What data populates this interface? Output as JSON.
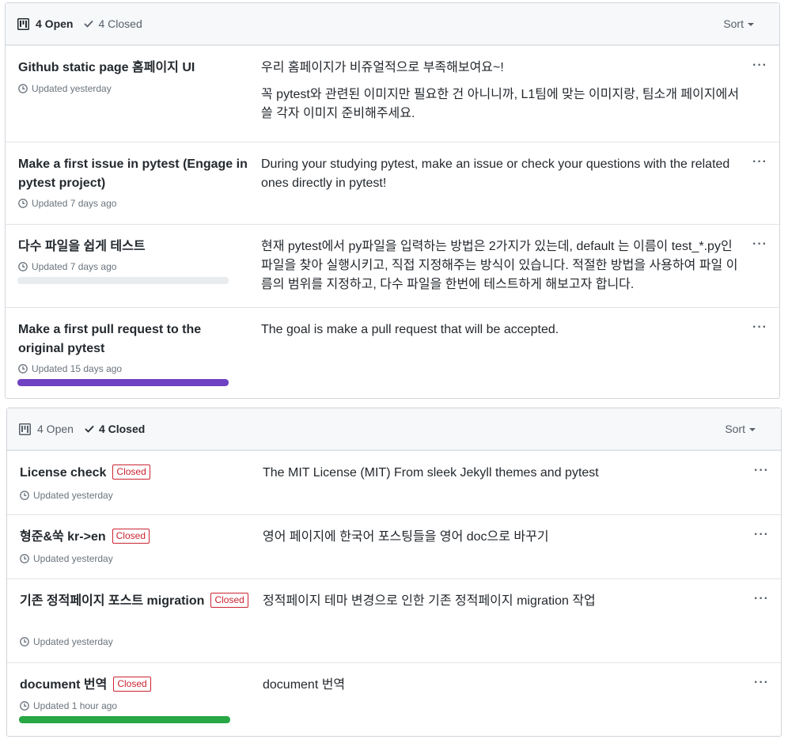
{
  "colors": {
    "purple": "#6f42c1",
    "green": "#28a745",
    "closed_red": "#cb2431",
    "track": "#e9ecef"
  },
  "panels": [
    {
      "open_label": "4 Open",
      "closed_label": "4 Closed",
      "active_state": "open",
      "sort_label": "Sort",
      "items": [
        {
          "title": "Github static page 홈페이지 UI",
          "updated": "Updated yesterday",
          "desc": [
            "우리 홈페이지가 비쥬얼적으로 부족해보여요~!",
            "꼭 pytest와 관련된 이미지만 필요한 건 아니니까, L1팀에 맞는 이미지랑, 팀소개 페이지에서 쓸 각자 이미지 준비해주세요."
          ],
          "more": "···"
        },
        {
          "title": "Make a first issue in pytest (Engage in pytest project)",
          "updated": "Updated 7 days ago",
          "desc": [
            "During your studying pytest, make an issue or check your questions with the related ones directly in pytest!"
          ],
          "more": "···"
        },
        {
          "title": "다수 파일을 쉽게 테스트",
          "updated": "Updated 7 days ago",
          "desc": [
            "현재 pytest에서 py파일을 입력하는 방법은 2가지가 있는데, default 는 이름이 test_*.py인 파일을 찾아 실행시키고, 직접 지정해주는 방식이 있습니다. 적절한 방법을 사용하여 파일 이름의 범위를 지정하고, 다수 파일을 한번에 테스트하게 해보고자 합니다."
          ],
          "more": "···",
          "progress": 0
        },
        {
          "title": "Make a first pull request to the original pytest",
          "updated": "Updated 15 days ago",
          "desc": [
            "The goal is make a pull request that will be accepted."
          ],
          "more": "···",
          "progress": 1.0
        }
      ]
    },
    {
      "open_label": "4 Open",
      "closed_label": "4 Closed",
      "active_state": "closed",
      "sort_label": "Sort",
      "items": [
        {
          "title": "License check",
          "badge": "Closed",
          "updated": "Updated yesterday",
          "desc": [
            "The MIT License (MIT) From sleek Jekyll themes and pytest"
          ],
          "more": "···"
        },
        {
          "title": "형준&쑥 kr->en",
          "badge": "Closed",
          "updated": "Updated yesterday",
          "desc": [
            "영어 페이지에 한국어 포스팅들을 영어 doc으로 바꾸기"
          ],
          "more": "···"
        },
        {
          "title": "기존 정적페이지 포스트 migration",
          "badge": "Closed",
          "updated": "Updated yesterday",
          "desc": [
            "정적페이지 테마 변경으로 인한 기존 정적페이지 migration 작업"
          ],
          "more": "···"
        },
        {
          "title": "document 번역",
          "badge": "Closed",
          "updated": "Updated 1 hour ago",
          "desc": [
            "document 번역"
          ],
          "more": "···",
          "progress": 1.0
        }
      ]
    }
  ]
}
